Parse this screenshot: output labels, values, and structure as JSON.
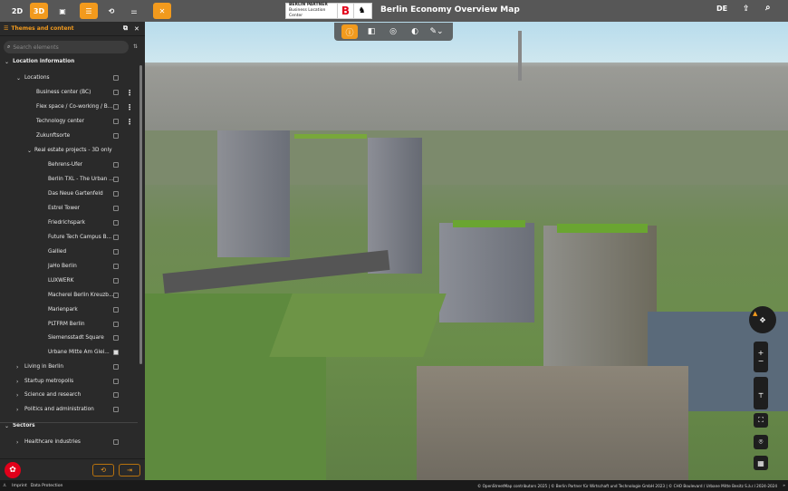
{
  "topbar": {
    "btn_2d": "2D",
    "btn_3d": "3D",
    "logo_line1": "BERLIN PARTNER",
    "logo_line2": "Business Location Center",
    "logo_mark": "B",
    "title": "Berlin Economy Overview Map",
    "lang": "DE"
  },
  "panel": {
    "title": "Themes and content",
    "search_placeholder": "Search elements"
  },
  "tree": [
    {
      "label": "Location information",
      "level": 0,
      "arrow": "v",
      "bold": true
    },
    {
      "label": "Locations",
      "level": 1,
      "arrow": "v",
      "cb": false
    },
    {
      "label": "Business center (BC)",
      "level": 2,
      "cb": false,
      "menu": true
    },
    {
      "label": "Flex space / Co-working / B...",
      "level": 2,
      "cb": false,
      "menu": true
    },
    {
      "label": "Technology center",
      "level": 2,
      "cb": false,
      "menu": true
    },
    {
      "label": "Zukunftsorte",
      "level": 2,
      "cb": false
    },
    {
      "label": "Real estate projects - 3D only",
      "level": 1.5,
      "arrow": "v"
    },
    {
      "label": "Behrens-Ufer",
      "level": 3,
      "cb": false
    },
    {
      "label": "Berlin TXL - The Urban ...",
      "level": 3,
      "cb": false
    },
    {
      "label": "Das Neue Gartenfeld",
      "level": 3,
      "cb": false
    },
    {
      "label": "Estrel Tower",
      "level": 3,
      "cb": false
    },
    {
      "label": "Friedrichspark",
      "level": 3,
      "cb": false
    },
    {
      "label": "Future Tech Campus B...",
      "level": 3,
      "cb": false
    },
    {
      "label": "Gallied",
      "level": 3,
      "cb": false
    },
    {
      "label": "JaHo Berlin",
      "level": 3,
      "cb": false
    },
    {
      "label": "LUXWERK",
      "level": 3,
      "cb": false
    },
    {
      "label": "Macherei Berlin Kreuzb...",
      "level": 3,
      "cb": false
    },
    {
      "label": "Marienpark",
      "level": 3,
      "cb": false
    },
    {
      "label": "PLTFRM Berlin",
      "level": 3,
      "cb": false
    },
    {
      "label": "Siemensstadt Square",
      "level": 3,
      "cb": false
    },
    {
      "label": "Urbane Mitte Am Glei...",
      "level": 3,
      "cb": true
    },
    {
      "label": "Living in Berlin",
      "level": 1,
      "arrow": ">",
      "cb": false
    },
    {
      "label": "Startup metropolis",
      "level": 1,
      "arrow": ">",
      "cb": false
    },
    {
      "label": "Science and research",
      "level": 1,
      "arrow": ">",
      "cb": false
    },
    {
      "label": "Politics and administration",
      "level": 1,
      "arrow": ">",
      "cb": false
    },
    {
      "label": "Sectors",
      "level": 0,
      "arrow": "v",
      "bold": true
    },
    {
      "label": "Healthcare industries",
      "level": 1,
      "arrow": ">",
      "cb": false
    }
  ],
  "footer": {
    "imprint": "Imprint",
    "privacy": "Data Protection"
  },
  "attribution": "© OpenStreetMap contributors 2025 | © Berlin Partner für Wirtschaft und Technologie GmbH 2023 | © CHO Boulevard / Urbane Mitte Besitz S.à.r.l 2024-2024",
  "colors": {
    "accent": "#f29a1d",
    "topbar": "#575757",
    "panel": "#2a2a2a"
  }
}
